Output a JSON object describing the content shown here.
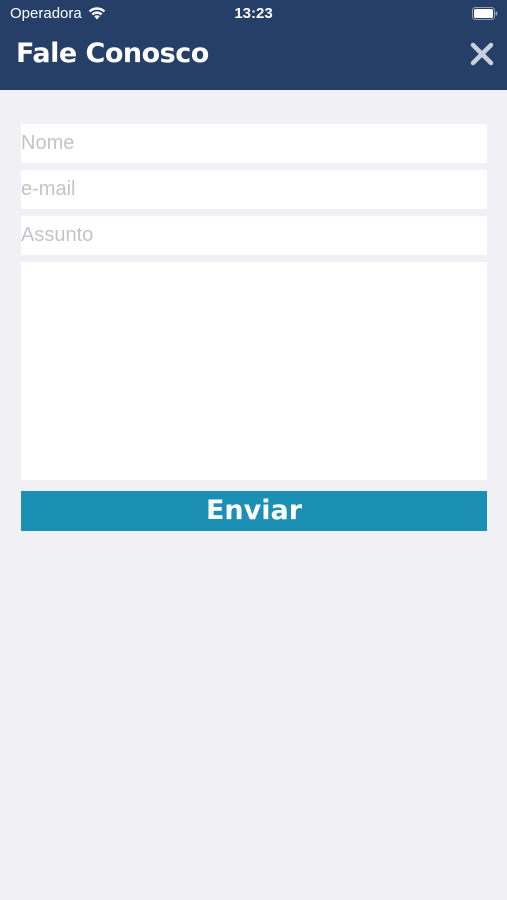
{
  "status_bar": {
    "carrier": "Operadora",
    "time": "13:23",
    "icons": [
      "wifi-icon",
      "battery-icon"
    ]
  },
  "header": {
    "title": "Fale Conosco",
    "close_icon": "close-icon"
  },
  "form": {
    "name": {
      "placeholder": "Nome",
      "value": ""
    },
    "email": {
      "placeholder": "e-mail",
      "value": ""
    },
    "subject": {
      "placeholder": "Assunto",
      "value": ""
    },
    "message": {
      "placeholder": "",
      "value": ""
    },
    "submit_label": "Enviar"
  },
  "colors": {
    "header_background": "#253f68",
    "page_background": "#f0f0f5",
    "button_background": "#1b8fb4",
    "field_background": "#ffffff",
    "placeholder_text": "#c4c4c8"
  }
}
